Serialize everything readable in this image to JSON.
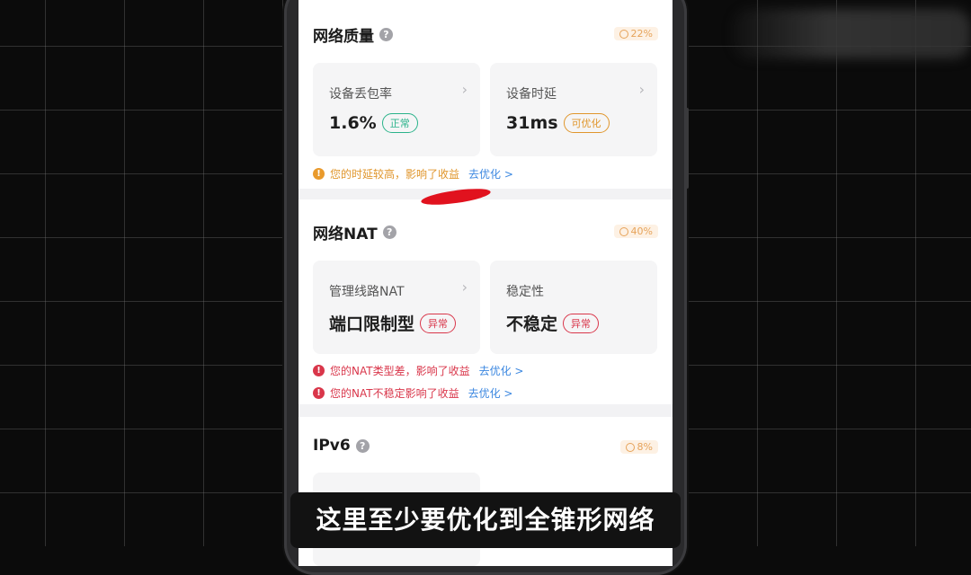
{
  "sections": {
    "quality": {
      "title": "网络质量",
      "weight": "22%",
      "tiles": [
        {
          "label": "设备丢包率",
          "value": "1.6%",
          "status": "正常"
        },
        {
          "label": "设备时延",
          "value": "31ms",
          "status": "可优化"
        }
      ],
      "alerts": [
        {
          "text": "您的时延较高，影响了收益",
          "link": "去优化 >"
        }
      ]
    },
    "nat": {
      "title": "网络NAT",
      "weight": "40%",
      "tiles": [
        {
          "label": "管理线路NAT",
          "value": "端口限制型",
          "status": "异常"
        },
        {
          "label": "稳定性",
          "value": "不稳定",
          "status": "异常"
        }
      ],
      "alerts": [
        {
          "text": "您的NAT类型差，影响了收益",
          "link": "去优化 >"
        },
        {
          "text": "您的NAT不稳定影响了收益",
          "link": "去优化 >"
        }
      ]
    },
    "ipv6": {
      "title": "IPv6",
      "weight": "8%"
    }
  },
  "subtitle": "这里至少要优化到全锥形网络",
  "colors": {
    "ok": "#2ab38a",
    "warn": "#e0962c",
    "error": "#d9364a",
    "link": "#3b87e0"
  },
  "icons": {
    "help": "question-circle-icon",
    "clock": "clock-icon",
    "chevron": "chevron-right-icon",
    "alert": "exclamation-circle-icon"
  }
}
